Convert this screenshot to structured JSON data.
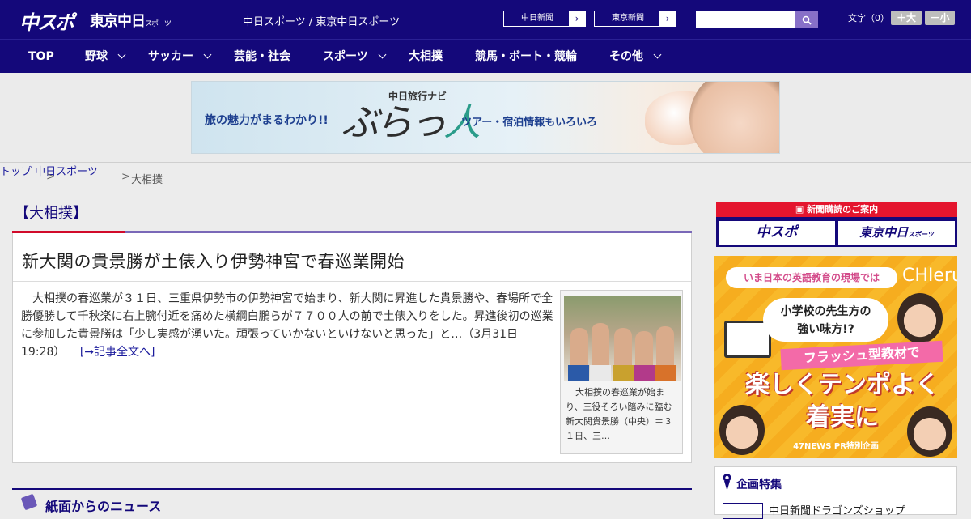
{
  "header": {
    "logo_main": "中スポ",
    "logo_tokyo": "東京中日",
    "logo_tokyo_suffix": "スポーツ",
    "site_name": "中日スポーツ / 東京中日スポーツ",
    "links": [
      {
        "label": "中日新聞"
      },
      {
        "label": "東京新聞"
      }
    ],
    "search": {
      "value": "",
      "placeholder": ""
    },
    "font_size_label": "文字（0）",
    "font_bigger": "＋大",
    "font_smaller": "－小"
  },
  "nav": {
    "items": [
      {
        "label": "TOP"
      },
      {
        "label": "野球"
      },
      {
        "label": "サッカー"
      },
      {
        "label": "芸能・社会"
      },
      {
        "label": "スポーツ"
      },
      {
        "label": "大相撲"
      },
      {
        "label": "競馬・ボート・競輪"
      },
      {
        "label": "その他"
      }
    ]
  },
  "banner": {
    "left_text": "旅の魅力がまるわかり!!",
    "brand_small": "中日旅行ナビ",
    "brand_big_a": "ぶらっ",
    "brand_big_b": "人",
    "right_text": "ツアー・宿泊情報もいろいろ"
  },
  "breadcrumb": {
    "items": [
      {
        "label": "トップ"
      },
      {
        "label": "中日スポーツ"
      },
      {
        "label": "大相撲"
      }
    ],
    "sep": ">"
  },
  "article": {
    "category": "【大相撲】",
    "headline": "新大関の貴景勝が土俵入り伊勢神宮で春巡業開始",
    "body": "大相撲の春巡業が３１日、三重県伊勢市の伊勢神宮で始まり、新大関に昇進した貴景勝や、春場所で全勝優勝して千秋楽に右上腕付近を痛めた横綱白鵬らが７７００人の前で土俵入りをした。昇進後初の巡業に参加した貴景勝は「少し実感が湧いた。頑張っていかないといけないと思った」と…",
    "timestamp": "（3月31日 19:28）",
    "read_more": "[→記事全文へ]",
    "photo_caption": "大相撲の春巡業が始まり、三役そろい踏みに臨む新大関貴景勝（中央）＝３１日、三…"
  },
  "section": {
    "title": "紙面からのニュース"
  },
  "sidebar": {
    "subscribe_head": "新聞購読のご案内",
    "subscribe_a": "中スポ",
    "subscribe_b": "東京中日",
    "subscribe_b_suffix": "スポーツ",
    "ad": {
      "top_pill": "いま日本の英語教育の現場では",
      "brand": "CHIeru",
      "bubble_l1": "小学校の先生方の",
      "bubble_l2": "強い味方!?",
      "pink": "フラッシュ型教材で",
      "big_l1": "楽しくテンポよく",
      "big_l2": "着実に",
      "footer": "47NEWS PR特別企画"
    },
    "kikaku_title": "企画特集",
    "kikaku_item": "中日新聞ドラゴンズショップ"
  },
  "colors": {
    "brand_navy": "#14087a",
    "accent_red": "#d10a2a",
    "link_blue": "#1b1b9c",
    "ad_yellow": "#f8b92a"
  }
}
